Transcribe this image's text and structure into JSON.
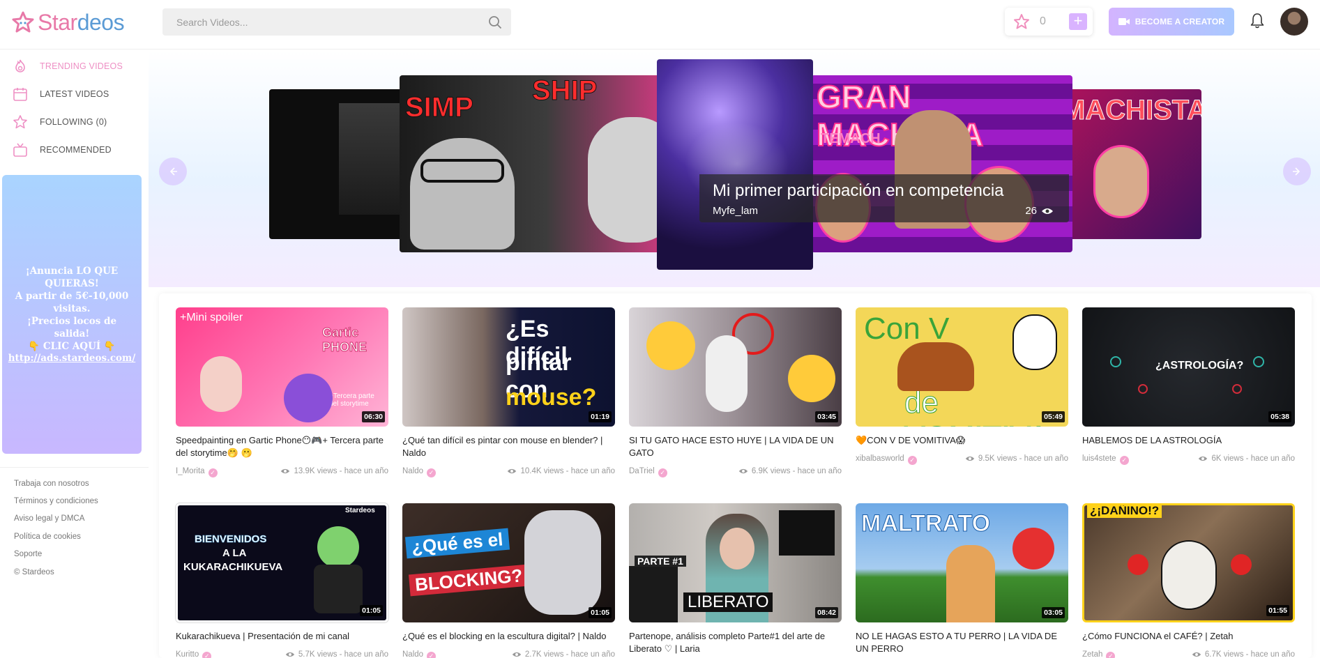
{
  "header": {
    "logo": {
      "part1": "Star",
      "part2": "deos"
    },
    "search": {
      "placeholder": "Search Videos..."
    },
    "stars": {
      "count": "0"
    },
    "creator_label": "BECOME A CREATOR"
  },
  "sidebar": {
    "items": [
      {
        "label": "TRENDING VIDEOS",
        "icon": "trending-icon"
      },
      {
        "label": "LATEST VIDEOS",
        "icon": "calendar-icon"
      },
      {
        "label": "FOLLOWING (0)",
        "icon": "star-icon"
      },
      {
        "label": "RECOMMENDED",
        "icon": "tv-icon"
      }
    ],
    "ad": {
      "lines": [
        "¡Anuncia LO QUE",
        "QUIERAS!",
        "A partir de 5€-10,000",
        "visitas.",
        "¡Precios locos de salida!",
        "👇 CLIC AQUÍ 👇"
      ],
      "link": "http://ads.stardeos.com/"
    },
    "footer": [
      "Trabaja con nosotros",
      "Términos y condiciones",
      "Aviso legal y DMCA",
      "Política de cookies",
      "Soporte",
      "© Stardeos"
    ]
  },
  "hero": {
    "caption_title": "Mi primer participación en competencia",
    "caption_channel": "Myfe_lam",
    "caption_views": "26",
    "slide_texts": [
      "SIMP",
      "SHIP",
      "GRAN MACHISTA",
      "MACHISTA",
      "TEMACH"
    ]
  },
  "videos": [
    {
      "title": "Speedpainting en Gartic Phone😶🎮+ Tercera parte del storytime🤭 🫢",
      "channel": "I_Morita",
      "views": "13.9K views - hace un año",
      "duration": "06:30",
      "thumb_texts": [
        "+Mini spoiler",
        "Gartic PHONE",
        "+Tercera parte del storytime"
      ]
    },
    {
      "title": "¿Qué tan difícil es pintar con mouse en blender? | Naldo",
      "channel": "Naldo",
      "views": "10.4K views - hace un año",
      "duration": "01:19",
      "thumb_texts": [
        "¿Es difícil",
        "pintar con",
        "mouse?"
      ]
    },
    {
      "title": "SI TU GATO HACE ESTO HUYE | LA VIDA DE UN GATO",
      "channel": "DaTriel",
      "views": "6.9K views - hace un año",
      "duration": "03:45",
      "thumb_texts": []
    },
    {
      "title": "🧡CON V DE VOMITIVA😱",
      "channel": "xibalbasworld",
      "views": "9.5K views - hace un año",
      "duration": "05:49",
      "thumb_texts": [
        "Con V",
        "de VOMITIVA"
      ]
    },
    {
      "title": "HABLEMOS DE LA ASTROLOGÍA",
      "channel": "luis4stete",
      "views": "6K views - hace un año",
      "duration": "05:38",
      "thumb_texts": [
        "¿ASTROLOGÍA?"
      ]
    },
    {
      "title": "Kukarachikueva | Presentación de mi canal",
      "channel": "Kuritto",
      "views": "5.7K views - hace un año",
      "duration": "01:05",
      "thumb_texts": [
        "BIENVENIDOS",
        "A LA",
        "KUKARACHIKUEVA",
        "Stardeos"
      ]
    },
    {
      "title": "¿Qué es el blocking en la escultura digital? | Naldo",
      "channel": "Naldo",
      "views": "2.7K views - hace un año",
      "duration": "01:05",
      "thumb_texts": [
        "¿Qué es el",
        "BLOCKING?"
      ]
    },
    {
      "title": "Partenope, análisis completo Parte#1 del arte de Liberato ♡ | Laria",
      "channel": "",
      "views": "",
      "duration": "08:42",
      "thumb_texts": [
        "PARTE #1",
        "LIBERATO"
      ]
    },
    {
      "title": "NO LE HAGAS ESTO A TU PERRO | LA VIDA DE UN PERRO",
      "channel": "",
      "views": "",
      "duration": "03:05",
      "thumb_texts": [
        "MALTRATO"
      ]
    },
    {
      "title": "¿Cómo FUNCIONA el CAFÉ? | Zetah",
      "channel": "Zetah",
      "views": "6.7K views - hace un año",
      "duration": "01:55",
      "thumb_texts": [
        "¿¡DAÑINO!?"
      ]
    }
  ],
  "colors": {
    "accent_pink": "#ee8fc4",
    "accent_blue": "#5b9bd5",
    "creator_gradient": [
      "#d3b4ff",
      "#a9c8ff"
    ]
  }
}
